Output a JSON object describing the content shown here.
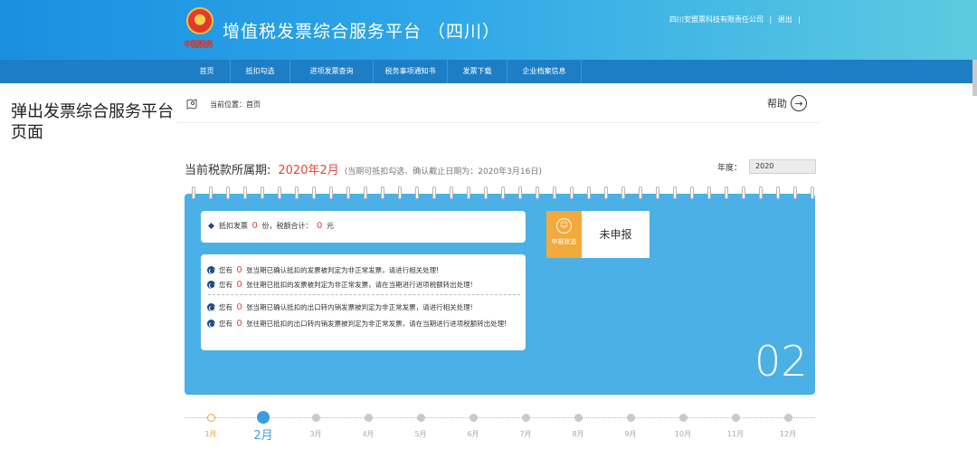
{
  "header": {
    "logo_text": "中国税务",
    "title": "增值税发票综合服务平台 （四川）",
    "company": "四川安盟票科技有限责任公司",
    "logout": "退出",
    "sep": "|"
  },
  "nav": {
    "items": [
      "首页",
      "抵扣勾选",
      "进项发票查询",
      "税务事项通知书",
      "发票下载",
      "企业档案信息"
    ]
  },
  "side_label": "弹出发票综合服务平台页面",
  "breadcrumb": {
    "label": "当前位置：",
    "current": "首页",
    "help": "帮助"
  },
  "period": {
    "label": "当前税款所属期:",
    "value": "2020年2月",
    "note": "(当期可抵扣勾选、确认截止日期为：2020年3月16日)",
    "year_label": "年度：",
    "year_value": "2020"
  },
  "summary": {
    "prefix": "抵扣发票",
    "count": "0",
    "count_unit": "份，税额合计：",
    "amount": "0",
    "amount_unit": "元"
  },
  "notices": [
    {
      "pre": "您有",
      "num": "0",
      "text": "张当期已确认抵扣的发票被判定为非正常发票，请进行相关处理!"
    },
    {
      "pre": "您有",
      "num": "0",
      "text": "张往期已抵扣的发票被判定为非正常发票，请在当期进行进项税额转出处理!"
    },
    {
      "pre": "您有",
      "num": "0",
      "text": "张当期已确认抵扣的出口转内销发票被判定为非正常发票，请进行相关处理!"
    },
    {
      "pre": "您有",
      "num": "0",
      "text": "张往期已抵扣的出口转内销发票被判定为非正常发票，请在当期进行进项税额转出处理!"
    }
  ],
  "status": {
    "badge": "申报状态",
    "value": "未申报"
  },
  "month_number": "02",
  "timeline": {
    "months": [
      "1月",
      "2月",
      "3月",
      "4月",
      "5月",
      "6月",
      "7月",
      "8月",
      "9月",
      "10月",
      "11月",
      "12月"
    ],
    "current_index": 1,
    "highlight_index": 0
  },
  "colors": {
    "header_start": "#1a8fe0",
    "header_end": "#5ccbe0",
    "nav": "#1d7ec6",
    "card": "#4ab0e6",
    "accent_red": "#e0463a",
    "status_orange": "#f3a93b",
    "current_month": "#3a9de0"
  }
}
